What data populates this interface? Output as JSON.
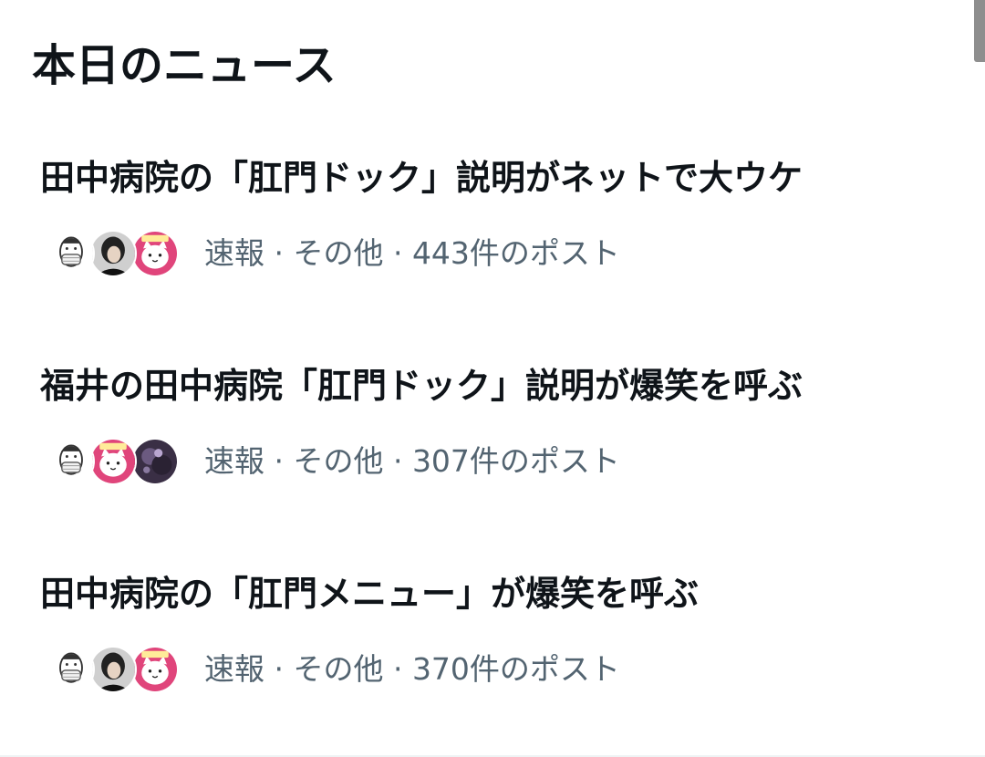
{
  "section": {
    "title": "本日のニュース"
  },
  "news": [
    {
      "headline": "田中病院の「肛門ドック」説明がネットで大ウケ",
      "meta": "速報 · その他 · 443件のポスト",
      "avatars": [
        "masked-face-avatar",
        "person-photo-avatar",
        "cat-character-avatar"
      ]
    },
    {
      "headline": "福井の田中病院「肛門ドック」説明が爆笑を呼ぶ",
      "meta": "速報 · その他 · 307件のポスト",
      "avatars": [
        "masked-face-avatar",
        "cat-character-avatar",
        "dark-illustration-avatar"
      ]
    },
    {
      "headline": "田中病院の「肛門メニュー」が爆笑を呼ぶ",
      "meta": "速報 · その他 · 370件のポスト",
      "avatars": [
        "masked-face-avatar",
        "person-photo-avatar",
        "cat-character-avatar"
      ]
    }
  ],
  "colors": {
    "headline_text": "#0f1419",
    "meta_text": "#536471",
    "background": "#ffffff",
    "avatar_pink": "#e0457b"
  }
}
